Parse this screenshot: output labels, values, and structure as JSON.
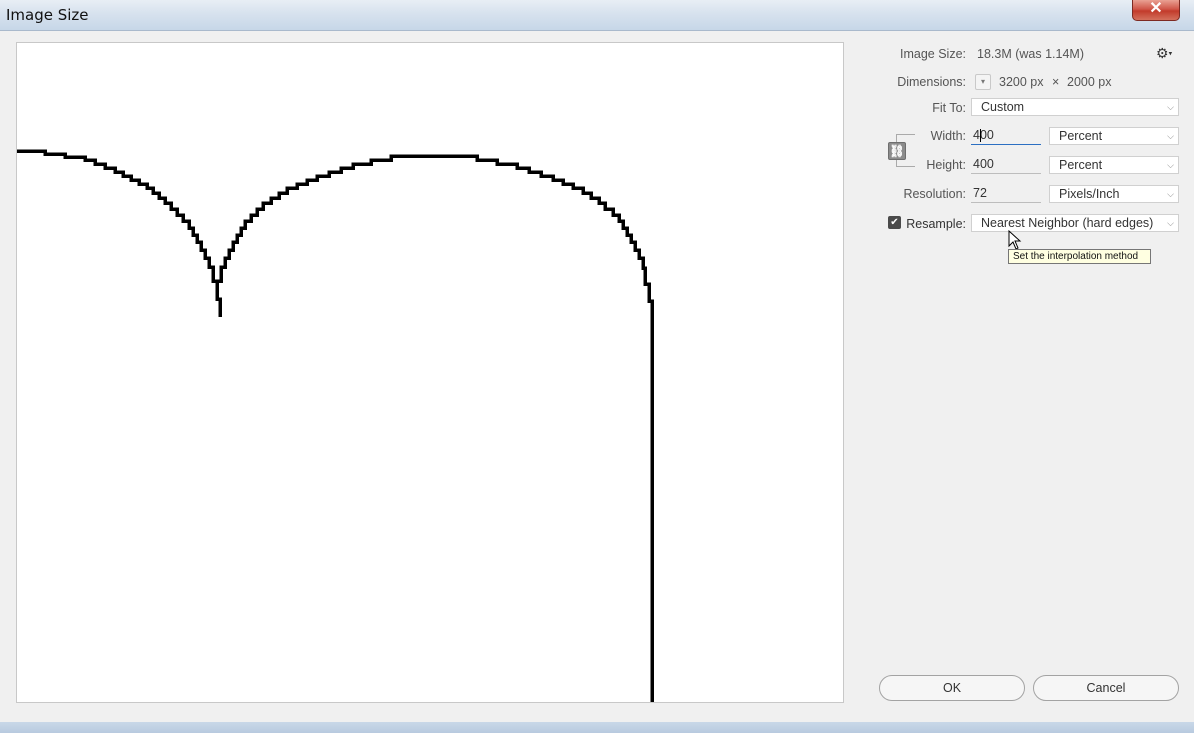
{
  "window": {
    "title": "Image Size",
    "close_glyph": "✕"
  },
  "info": {
    "image_size_label": "Image Size:",
    "image_size_value": "18.3M (was 1.14M)",
    "dimensions_label": "Dimensions:",
    "dimensions_width": "3200 px",
    "dimensions_times": "×",
    "dimensions_height": "2000 px"
  },
  "fit_to": {
    "label": "Fit To:",
    "value": "Custom"
  },
  "width": {
    "label": "Width:",
    "value": "400",
    "unit": "Percent"
  },
  "height": {
    "label": "Height:",
    "value": "400",
    "unit": "Percent"
  },
  "resolution": {
    "label": "Resolution:",
    "value": "72",
    "unit": "Pixels/Inch"
  },
  "resample": {
    "label": "Resample:",
    "checked": true,
    "value": "Nearest Neighbor (hard edges)"
  },
  "tooltip": "Set the interpolation method",
  "buttons": {
    "ok": "OK",
    "cancel": "Cancel"
  },
  "icons": {
    "gear": "gear-icon",
    "chain": "link-icon",
    "check": "checkmark-icon",
    "chevron": "chevron-down-icon",
    "cursor": "mouse-pointer-icon"
  },
  "colors": {
    "preview_stroke": "#000000",
    "tooltip_bg": "#ffffe1",
    "focus_underline": "#2b6fc2",
    "close_button": "#c23b2b"
  }
}
